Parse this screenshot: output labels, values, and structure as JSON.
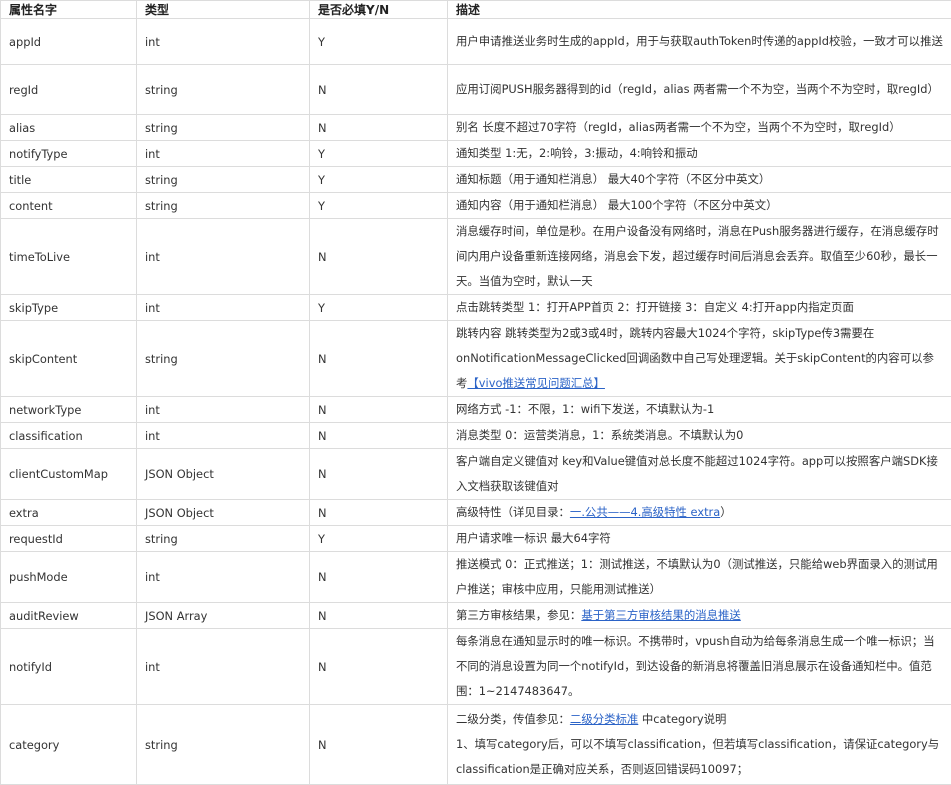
{
  "headers": [
    "属性名字",
    "类型",
    "是否必填Y/N",
    "描述"
  ],
  "rows": [
    {
      "name": "appId",
      "type": "int",
      "required": "Y",
      "h": 46,
      "desc": [
        {
          "t": "用户申请推送业务时生成的appId，用于与获取authToken时传递的appId校验，一致才可以推送"
        }
      ]
    },
    {
      "name": "regId",
      "type": "string",
      "required": "N",
      "h": 50,
      "desc": [
        {
          "t": "应用订阅PUSH服务器得到的id（regId，alias 两者需一个不为空，当两个不为空时，取regId）"
        }
      ]
    },
    {
      "name": "alias",
      "type": "string",
      "required": "N",
      "h": 26,
      "desc": [
        {
          "t": "别名 长度不超过70字符（regId，alias两者需一个不为空，当两个不为空时，取regId）"
        }
      ]
    },
    {
      "name": "notifyType",
      "type": "int",
      "required": "Y",
      "h": 26,
      "desc": [
        {
          "t": "通知类型 1:无，2:响铃，3:振动，4:响铃和振动"
        }
      ]
    },
    {
      "name": "title",
      "type": "string",
      "required": "Y",
      "h": 26,
      "desc": [
        {
          "t": "通知标题（用于通知栏消息） 最大40个字符（不区分中英文）"
        }
      ]
    },
    {
      "name": "content",
      "type": "string",
      "required": "Y",
      "h": 26,
      "desc": [
        {
          "t": "通知内容（用于通知栏消息） 最大100个字符（不区分中英文）"
        }
      ]
    },
    {
      "name": "timeToLive",
      "type": "int",
      "required": "N",
      "h": 76,
      "desc": [
        {
          "t": "消息缓存时间，单位是秒。在用户设备没有网络时，消息在Push服务器进行缓存，在消息缓存时间内用户设备重新连接网络，消息会下发，超过缓存时间后消息会丢弃。取值至少60秒，最长一天。当值为空时，默认一天"
        }
      ]
    },
    {
      "name": "skipType",
      "type": "int",
      "required": "Y",
      "h": 26,
      "desc": [
        {
          "t": "点击跳转类型 1：打开APP首页 2：打开链接 3：自定义 4:打开app内指定页面"
        }
      ]
    },
    {
      "name": "skipContent",
      "type": "string",
      "required": "N",
      "h": 76,
      "desc": [
        {
          "t": "跳转内容 跳转类型为2或3或4时，跳转内容最大1024个字符，skipType传3需要在onNotificationMessageClicked回调函数中自己写处理逻辑。关于skipContent的内容可以参考"
        },
        {
          "t": "【vivo推送常见问题汇总】",
          "link": true
        }
      ]
    },
    {
      "name": "networkType",
      "type": "int",
      "required": "N",
      "h": 26,
      "desc": [
        {
          "t": "网络方式 -1：不限，1：wifi下发送，不填默认为-1"
        }
      ]
    },
    {
      "name": "classification",
      "type": "int",
      "required": "N",
      "h": 26,
      "desc": [
        {
          "t": "消息类型 0：运营类消息，1：系统类消息。不填默认为0"
        }
      ]
    },
    {
      "name": "clientCustomMap",
      "type": "JSON Object",
      "required": "N",
      "h": 50,
      "desc": [
        {
          "t": "客户端自定义键值对 key和Value键值对总长度不能超过1024字符。app可以按照客户端SDK接入文档获取该键值对"
        }
      ]
    },
    {
      "name": "extra",
      "type": "JSON Object",
      "required": "N",
      "h": 26,
      "desc": [
        {
          "t": "高级特性（详见目录："
        },
        {
          "t": "一.公共——4.高级特性 extra",
          "link": true
        },
        {
          "t": "）"
        }
      ]
    },
    {
      "name": "requestId",
      "type": "string",
      "required": "Y",
      "h": 26,
      "desc": [
        {
          "t": "用户请求唯一标识 最大64字符"
        }
      ]
    },
    {
      "name": "pushMode",
      "type": "int",
      "required": "N",
      "h": 50,
      "desc": [
        {
          "t": "推送模式 0：正式推送；1：测试推送，不填默认为0（测试推送，只能给web界面录入的测试用户推送；审核中应用，只能用测试推送）"
        }
      ]
    },
    {
      "name": "auditReview",
      "type": "JSON Array",
      "required": "N",
      "h": 26,
      "desc": [
        {
          "t": "第三方审核结果，参见："
        },
        {
          "t": "基于第三方审核结果的消息推送",
          "link": true
        }
      ]
    },
    {
      "name": "notifyId",
      "type": "int",
      "required": "N",
      "h": 76,
      "desc": [
        {
          "t": "每条消息在通知显示时的唯一标识。不携带时，vpush自动为给每条消息生成一个唯一标识；当不同的消息设置为同一个notifyId，到达设备的新消息将覆盖旧消息展示在设备通知栏中。值范围：1~2147483647。"
        }
      ]
    },
    {
      "name": "category",
      "type": "string",
      "required": "N",
      "h": 80,
      "desc": [
        {
          "t": "二级分类，传值参见："
        },
        {
          "t": "二级分类标准",
          "link": true
        },
        {
          "t": " 中category说明",
          "br": true
        },
        {
          "t": "1、填写category后，可以不填写classification，但若填写classification，请保证category与classification是正确对应关系，否则返回错误码10097；"
        }
      ]
    }
  ]
}
